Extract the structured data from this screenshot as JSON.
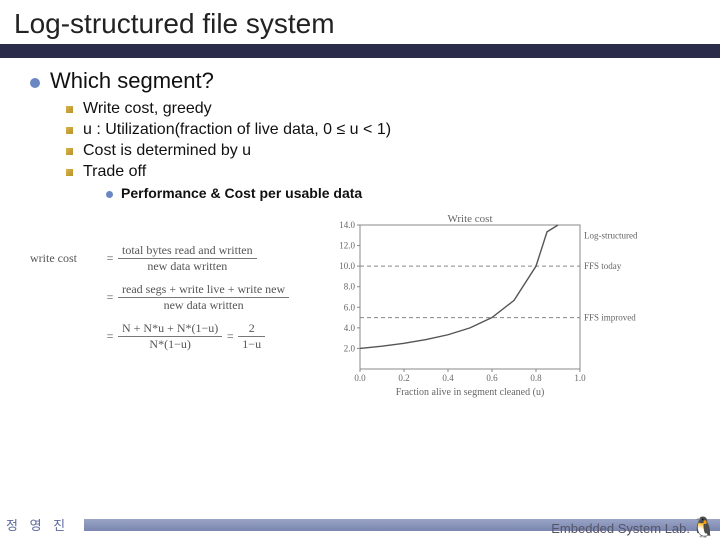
{
  "title": "Log-structured file system",
  "heading": "Which segment?",
  "bullets": [
    "Write cost, greedy",
    "u : Utilization(fraction of live data, 0 ≤ u < 1)",
    "Cost is determined by u",
    "Trade off"
  ],
  "subbullet": "Performance & Cost per usable data",
  "formula": {
    "lhs": "write cost",
    "line1_num": "total bytes read and written",
    "line1_den": "new data written",
    "line2_num": "read segs + write live + write new",
    "line2_den": "new data written",
    "line3_num": "N + N*u + N*(1−u)",
    "line3_den": "N*(1−u)",
    "line3_rhs_num": "2",
    "line3_rhs_den": "1−u"
  },
  "footer_name": "정 영 진",
  "footer_lab": "Embedded System Lab.",
  "chart_data": {
    "type": "line",
    "title": "Write cost",
    "xlabel": "Fraction alive in segment cleaned (u)",
    "ylabel": "Write cost",
    "xlim": [
      0.0,
      1.0
    ],
    "ylim": [
      0.0,
      14.0
    ],
    "xticks": [
      0.0,
      0.2,
      0.4,
      0.6,
      0.8,
      1.0
    ],
    "yticks": [
      2.0,
      4.0,
      6.0,
      8.0,
      10.0,
      12.0,
      14.0
    ],
    "series": [
      {
        "name": "Log-structured",
        "x": [
          0.0,
          0.1,
          0.2,
          0.3,
          0.4,
          0.5,
          0.6,
          0.7,
          0.8,
          0.85,
          0.9
        ],
        "y": [
          2.0,
          2.22,
          2.5,
          2.86,
          3.33,
          4.0,
          5.0,
          6.67,
          10.0,
          13.33,
          20.0
        ]
      }
    ],
    "hlines": [
      {
        "name": "FFS today",
        "y": 10.0,
        "style": "dashed"
      },
      {
        "name": "FFS improved",
        "y": 5.0,
        "style": "dashed"
      }
    ]
  }
}
